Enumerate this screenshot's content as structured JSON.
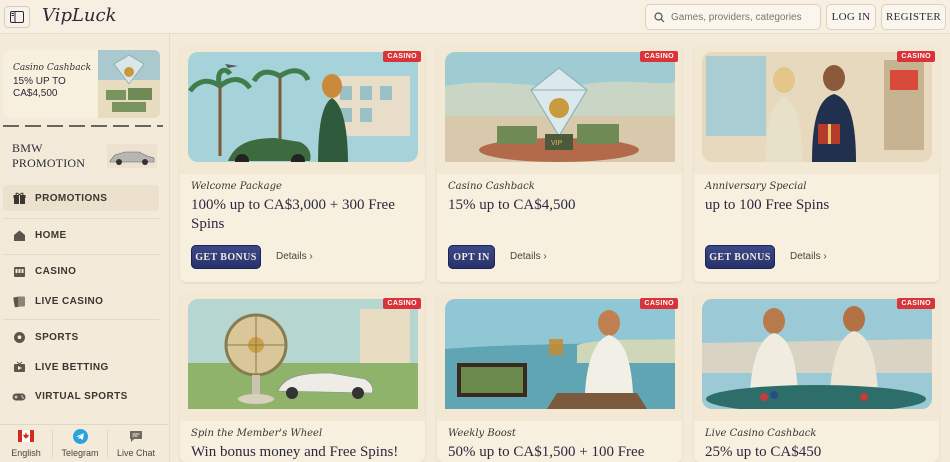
{
  "header": {
    "logo": "VipLuck",
    "search_placeholder": "Games, providers, categories",
    "login": "LOG IN",
    "register": "REGISTER"
  },
  "sidebar": {
    "promo_card": {
      "script": "Casino Cashback",
      "text": "15% UP TO CA$4,500"
    },
    "bmw": "BMW PROMOTION",
    "nav": [
      {
        "label": "PROMOTIONS",
        "icon": "gift-icon",
        "active": true
      },
      {
        "label": "HOME",
        "icon": "home-icon"
      },
      {
        "label": "CASINO",
        "icon": "slot-machine-icon"
      },
      {
        "label": "LIVE CASINO",
        "icon": "cards-icon"
      },
      {
        "label": "SPORTS",
        "icon": "soccer-ball-icon"
      },
      {
        "label": "LIVE BETTING",
        "icon": "tv-icon"
      },
      {
        "label": "VIRTUAL SPORTS",
        "icon": "gamepad-icon"
      }
    ],
    "bottom": [
      {
        "label": "English",
        "icon": "canada-flag-icon"
      },
      {
        "label": "Telegram",
        "icon": "telegram-icon"
      },
      {
        "label": "Live Chat",
        "icon": "chat-icon"
      }
    ]
  },
  "cards": [
    {
      "badge": "CASINO",
      "subtitle": "Welcome Package",
      "title": "100% up to CA$3,000 + 300 Free Spins",
      "cta": "GET BONUS",
      "details": "Details"
    },
    {
      "badge": "CASINO",
      "subtitle": "Casino Cashback",
      "title": "15% up to CA$4,500",
      "cta": "OPT IN",
      "details": "Details"
    },
    {
      "badge": "CASINO",
      "subtitle": "Anniversary Special",
      "title": "up to 100 Free Spins",
      "cta": "GET BONUS",
      "details": "Details"
    },
    {
      "badge": "CASINO",
      "subtitle": "Spin the Member's Wheel",
      "title": "Win bonus money and Free Spins!"
    },
    {
      "badge": "CASINO",
      "subtitle": "Weekly Boost",
      "title": "50% up to CA$1,500 + 100 Free"
    },
    {
      "badge": "CASINO",
      "subtitle": "Live Casino Cashback",
      "title": "25% up to CA$450"
    }
  ]
}
